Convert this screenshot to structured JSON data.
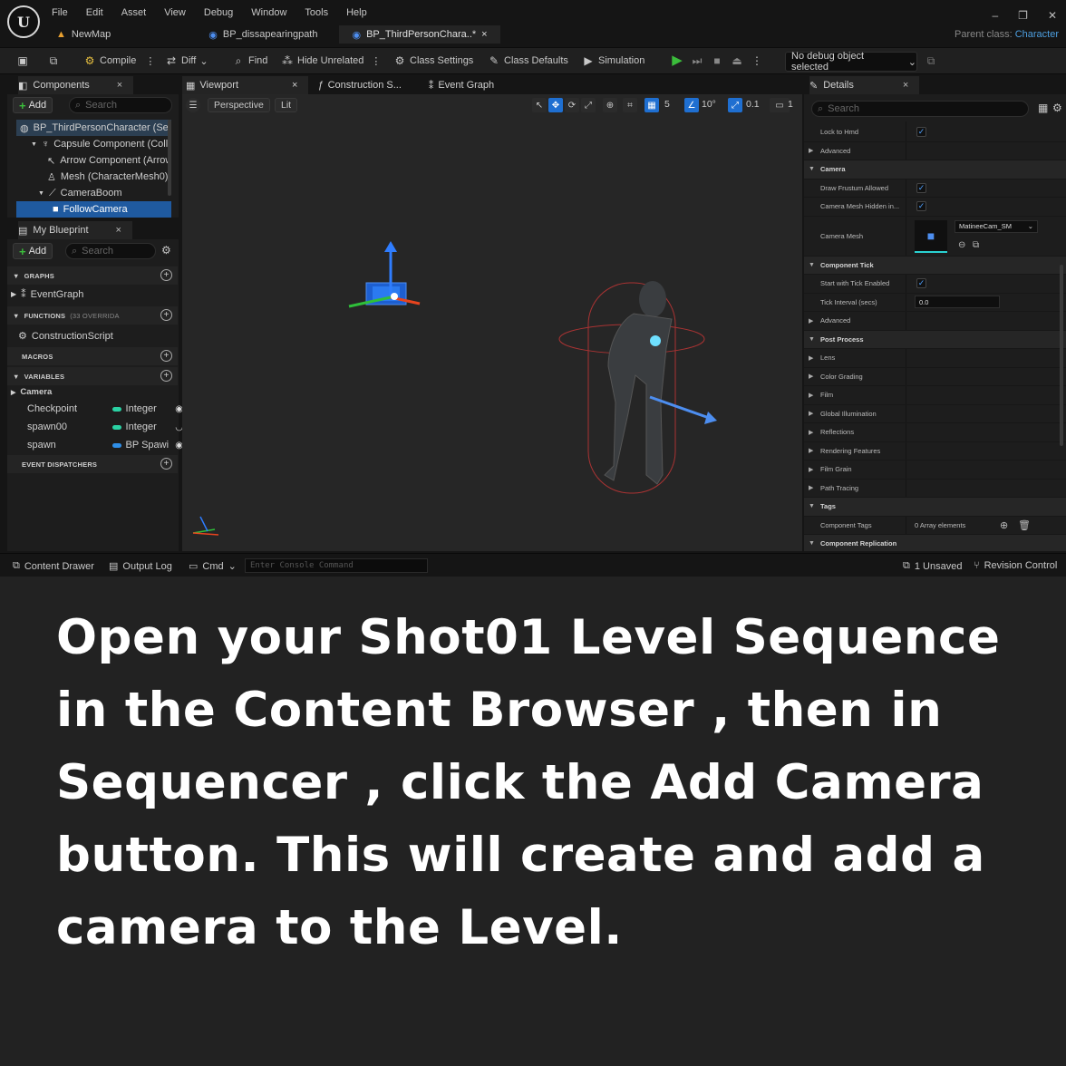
{
  "menu": [
    "File",
    "Edit",
    "Asset",
    "View",
    "Debug",
    "Window",
    "Tools",
    "Help"
  ],
  "doc_tabs": [
    {
      "label": "NewMap",
      "icon": "map-icon"
    },
    {
      "label": "BP_dissapearingpath",
      "icon": "blueprint-icon"
    },
    {
      "label": "BP_ThirdPersonChara..*",
      "icon": "blueprint-icon",
      "active": true
    }
  ],
  "parent_class": {
    "label": "Parent class:",
    "value": "Character"
  },
  "toolbar": {
    "compile": "Compile",
    "diff": "Diff",
    "find": "Find",
    "hide_unrelated": "Hide Unrelated",
    "class_settings": "Class Settings",
    "class_defaults": "Class Defaults",
    "simulation": "Simulation",
    "debug_object": "No debug object selected"
  },
  "components": {
    "title": "Components",
    "add": "Add",
    "search_placeholder": "Search",
    "items": [
      "BP_ThirdPersonCharacter (Sel",
      "Capsule Component (Collisi",
      "Arrow Component (Arrow)",
      "Mesh (CharacterMesh0)",
      "CameraBoom",
      "FollowCamera"
    ]
  },
  "my_blueprint": {
    "title": "My Blueprint",
    "add": "Add",
    "search_placeholder": "Search",
    "graphs": "GRAPHS",
    "event_graph": "EventGraph",
    "functions": "FUNCTIONS",
    "functions_count": "(33 OVERRIDA",
    "construction_script": "ConstructionScript",
    "macros": "MACROS",
    "variables": "VARIABLES",
    "camera_group": "Camera",
    "variables_list": [
      {
        "name": "Checkpoint",
        "type": "Integer",
        "color": "#2ad1a3"
      },
      {
        "name": "spawn00",
        "type": "Integer",
        "color": "#2ad1a3"
      },
      {
        "name": "spawn",
        "type": "BP Spawi",
        "color": "#2f8fe8"
      }
    ],
    "event_dispatchers": "EVENT DISPATCHERS"
  },
  "viewport": {
    "tabs": [
      "Viewport",
      "Construction S...",
      "Event Graph"
    ],
    "perspective": "Perspective",
    "lit": "Lit",
    "grid_value": "5",
    "angle_value": "10°",
    "scale_value": "0.1",
    "camera_speed": "1"
  },
  "details": {
    "title": "Details",
    "search_placeholder": "Search",
    "rows": [
      {
        "label": "Lock to Hmd",
        "kind": "check"
      },
      {
        "label": "Advanced",
        "kind": "sub"
      },
      {
        "label": "Camera",
        "kind": "hdr"
      },
      {
        "label": "Draw Frustum Allowed",
        "kind": "check"
      },
      {
        "label": "Camera Mesh Hidden in...",
        "kind": "check"
      },
      {
        "label": "Camera Mesh",
        "kind": "mesh",
        "value": "MatineeCam_SM"
      },
      {
        "label": "Component Tick",
        "kind": "hdr"
      },
      {
        "label": "Start with Tick Enabled",
        "kind": "check"
      },
      {
        "label": "Tick Interval (secs)",
        "kind": "field",
        "value": "0.0"
      },
      {
        "label": "Advanced",
        "kind": "sub"
      },
      {
        "label": "Post Process",
        "kind": "hdr"
      },
      {
        "label": "Lens",
        "kind": "sub"
      },
      {
        "label": "Color Grading",
        "kind": "sub"
      },
      {
        "label": "Film",
        "kind": "sub"
      },
      {
        "label": "Global Illumination",
        "kind": "sub"
      },
      {
        "label": "Reflections",
        "kind": "sub"
      },
      {
        "label": "Rendering Features",
        "kind": "sub"
      },
      {
        "label": "Film Grain",
        "kind": "sub"
      },
      {
        "label": "Path Tracing",
        "kind": "sub"
      },
      {
        "label": "Tags",
        "kind": "hdr"
      },
      {
        "label": "Component Tags",
        "kind": "tags",
        "value": "0 Array elements"
      },
      {
        "label": "Component Replication",
        "kind": "hdr"
      }
    ]
  },
  "status": {
    "content_drawer": "Content Drawer",
    "output_log": "Output Log",
    "cmd": "Cmd",
    "console_placeholder": "Enter Console Command",
    "unsaved": "1 Unsaved",
    "revision_control": "Revision Control"
  },
  "caption": "Open your Shot01 Level Sequence in the Content Browser , then in Sequencer , click the Add Camera button. This will create and add a camera to the Level."
}
